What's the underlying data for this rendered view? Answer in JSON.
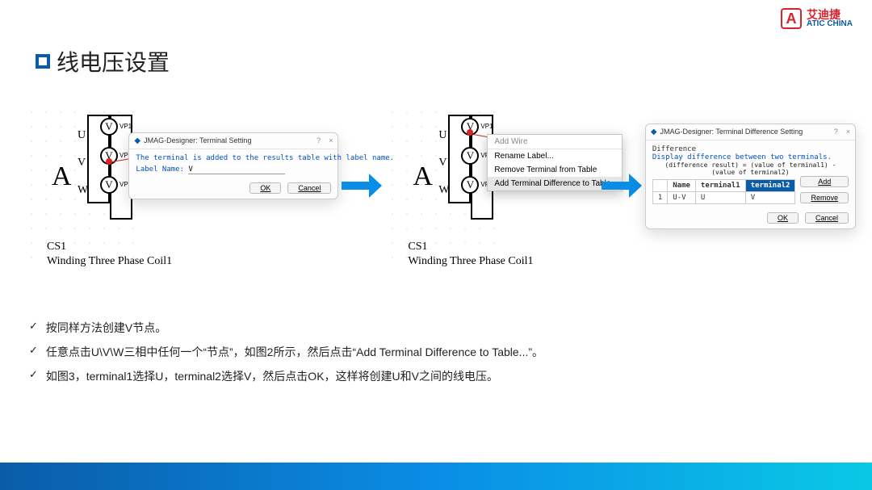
{
  "brand": {
    "cn": "艾迪捷",
    "en": "ATIC CHINA"
  },
  "title": "线电压设置",
  "diagram": {
    "A": "A",
    "phases": [
      "U",
      "V",
      "W"
    ],
    "probe_label": "V",
    "vp_labels": [
      "VP1",
      "VP2",
      "VP3"
    ],
    "cs1": "CS1",
    "winding": "Winding Three Phase Coil1"
  },
  "dlg_terminal": {
    "title": "JMAG-Designer: Terminal Setting",
    "help": "?",
    "close": "×",
    "body_line": "The terminal is added to the results table with label name.",
    "label_prompt": "Label Name:",
    "label_value": "V",
    "ok": "OK",
    "cancel": "Cancel"
  },
  "ctx_menu": {
    "header": "Add Wire",
    "items": [
      "Rename Label...",
      "Remove Terminal from Table",
      "Add Terminal Difference to Table..."
    ],
    "active_index": 2
  },
  "dlg_diff": {
    "title": "JMAG-Designer: Terminal Difference Setting",
    "help": "?",
    "close": "×",
    "section": "Difference",
    "desc": "Display difference between two terminals.",
    "formula": "(difference result) = (value of terminal1) - (value of terminal2)",
    "cols": [
      "Name",
      "terminal1",
      "terminal2"
    ],
    "row": {
      "idx": "1",
      "name": "U-V",
      "t1": "U",
      "t2": "V"
    },
    "add": "Add",
    "remove": "Remove",
    "ok": "OK",
    "cancel": "Cancel"
  },
  "bullets": [
    "按同样方法创建V节点。",
    "任意点击U\\V\\W三相中任何一个“节点”，如图2所示，然后点击“Add Terminal Difference to Table...”。",
    "如图3，terminal1选择U，terminal2选择V，然后点击OK，这样将创建U和V之间的线电压。"
  ]
}
